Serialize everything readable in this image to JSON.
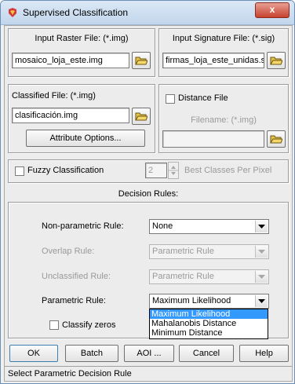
{
  "window": {
    "title": "Supervised Classification",
    "close_label": "x"
  },
  "input_raster": {
    "label": "Input Raster File: (*.img)",
    "value": "mosaico_loja_este.img"
  },
  "input_signature": {
    "label": "Input Signature File: (*.sig)",
    "value": "firmas_loja_este_unidas.sig"
  },
  "classified": {
    "label": "Classified File: (*.img)",
    "value": "clasificación.img",
    "attribute_button": "Attribute Options..."
  },
  "distance": {
    "checkbox_label": "Distance File",
    "filename_label": "Filename: (*.img)",
    "value": ""
  },
  "fuzzy": {
    "checkbox_label": "Fuzzy Classification",
    "spin_value": "2",
    "best_classes_label": "Best Classes Per Pixel"
  },
  "decision_rules": {
    "heading": "Decision Rules:",
    "non_parametric_label": "Non-parametric Rule:",
    "non_parametric_value": "None",
    "overlap_label": "Overlap Rule:",
    "overlap_value": "Parametric Rule",
    "unclassified_label": "Unclassified Rule:",
    "unclassified_value": "Parametric Rule",
    "parametric_label": "Parametric Rule:",
    "parametric_value": "Maximum Likelihood",
    "parametric_options": [
      "Maximum Likelihood",
      "Mahalanobis Distance",
      "Minimum Distance"
    ],
    "classify_zeros_label": "Classify zeros"
  },
  "buttons": {
    "ok": "OK",
    "batch": "Batch",
    "aoi": "AOI ...",
    "cancel": "Cancel",
    "help": "Help"
  },
  "status_text": "Select Parametric Decision Rule",
  "colors": {
    "accent": "#3399ff",
    "title_bar": "#c2d6ec",
    "close": "#c7412f"
  }
}
